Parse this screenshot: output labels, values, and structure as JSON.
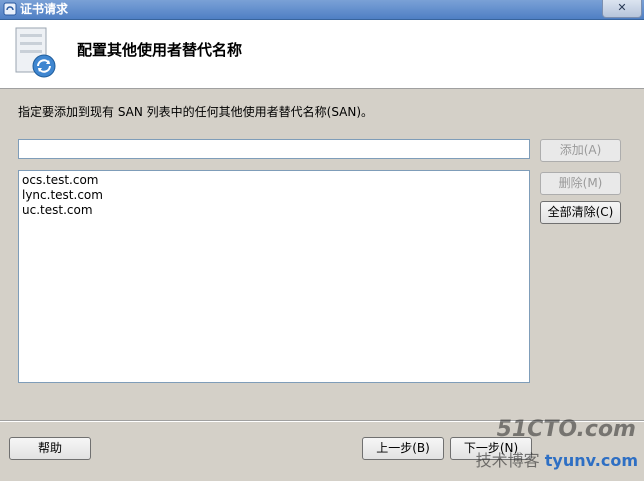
{
  "window": {
    "title": "证书请求",
    "close_label": "✕"
  },
  "header": {
    "title": "配置其他使用者替代名称",
    "icon": "certificate-request-icon"
  },
  "form": {
    "instructions": "指定要添加到现有 SAN 列表中的任何其他使用者替代名称(SAN)。",
    "san_input_value": "",
    "san_list": [
      "ocs.test.com",
      "lync.test.com",
      "uc.test.com"
    ],
    "buttons": {
      "add": "添加(A)",
      "remove": "删除(M)",
      "clear_all": "全部清除(C)"
    }
  },
  "footer": {
    "help": "帮助",
    "back": "上一步(B)",
    "next": "下一步(N)"
  },
  "watermark": {
    "line1": "51CTO.com",
    "line2_prefix": "技术博客",
    "line2_url": "tyunv.com"
  },
  "colors": {
    "titlebar": "#4f7fc4",
    "header_bg": "#ffffff",
    "dialog_bg": "#d4d0c8",
    "input_border": "#7f9db9"
  }
}
